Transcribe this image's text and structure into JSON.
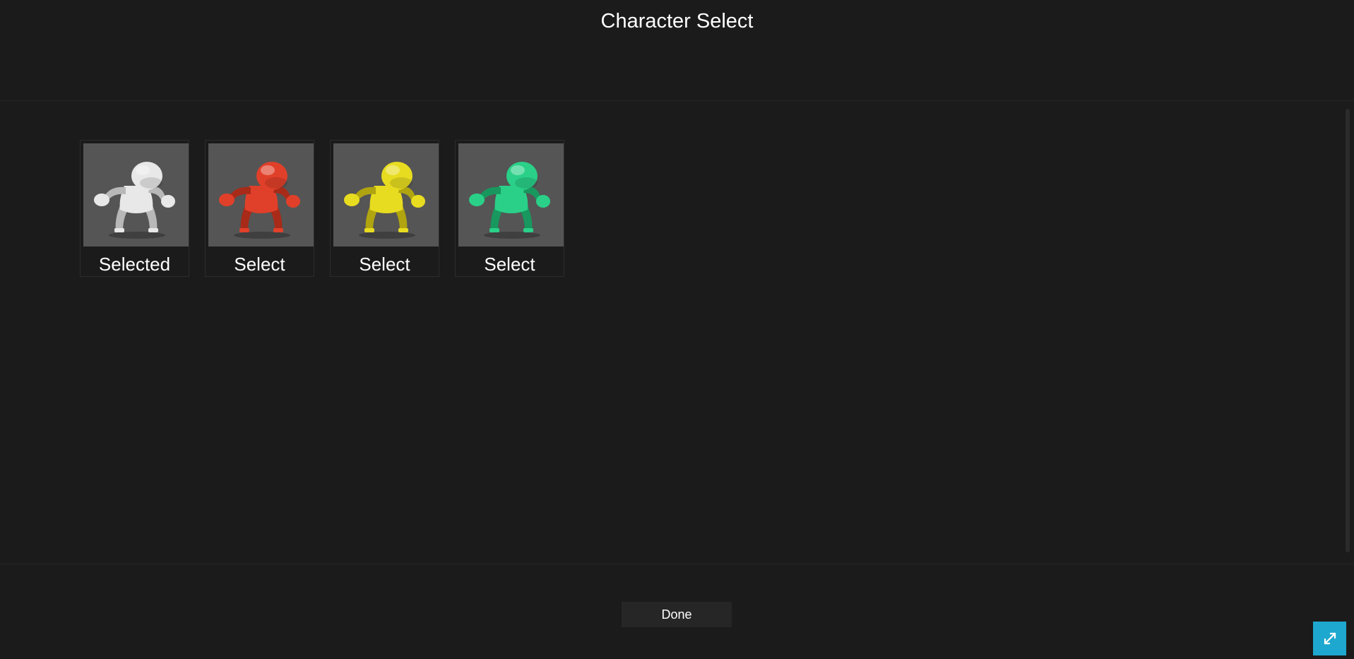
{
  "header": {
    "title": "Character Select"
  },
  "characters": [
    {
      "color": "#e8e8e8",
      "shade": "#b8b8b8",
      "label": "Selected",
      "icon": "character-figure-icon"
    },
    {
      "color": "#e0402a",
      "shade": "#a82a18",
      "label": "Select",
      "icon": "character-figure-icon"
    },
    {
      "color": "#e8dc20",
      "shade": "#b0a410",
      "label": "Select",
      "icon": "character-figure-icon"
    },
    {
      "color": "#2ad088",
      "shade": "#18985e",
      "label": "Select",
      "icon": "character-figure-icon"
    }
  ],
  "footer": {
    "done_label": "Done"
  },
  "fullscreen": {
    "icon": "expand-icon",
    "color": "#1ea8cf"
  }
}
